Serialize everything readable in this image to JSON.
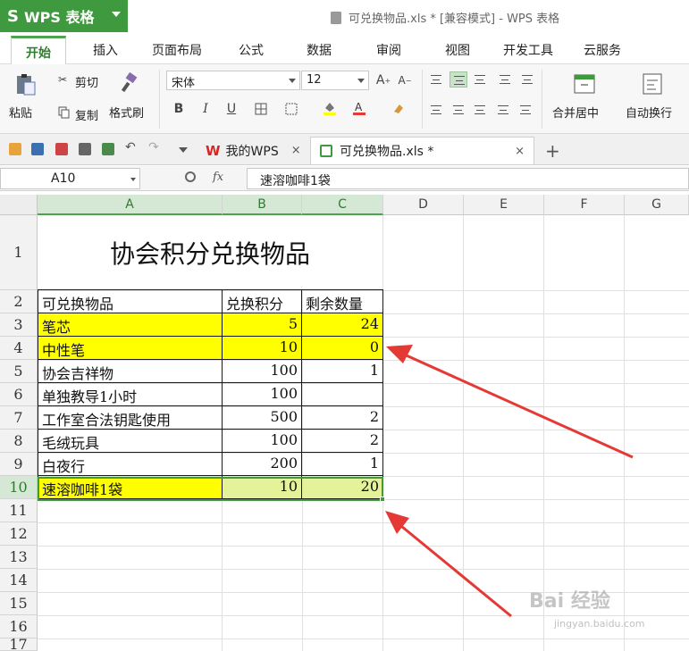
{
  "app": {
    "name": "WPS 表格",
    "logo": "S",
    "window_title": "可兑换物品.xls * [兼容模式] - WPS 表格"
  },
  "menu": [
    "开始",
    "插入",
    "页面布局",
    "公式",
    "数据",
    "审阅",
    "视图",
    "开发工具",
    "云服务"
  ],
  "ribbon": {
    "paste": "粘贴",
    "cut": "剪切",
    "copy": "复制",
    "format_painter": "格式刷",
    "font_name": "宋体",
    "font_size": "12",
    "bold": "B",
    "italic": "I",
    "underline": "U",
    "merge_center": "合并居中",
    "wrap_text": "自动换行"
  },
  "tabs": [
    {
      "label": "我的WPS",
      "close": "×"
    },
    {
      "label": "可兑换物品.xls *",
      "close": "×"
    }
  ],
  "new_tab": "+",
  "formula_bar": {
    "cell_ref": "A10",
    "fx": "fx",
    "content": "速溶咖啡1袋"
  },
  "columns": [
    "A",
    "B",
    "C",
    "D",
    "E",
    "F",
    "G"
  ],
  "rows": [
    "1",
    "2",
    "3",
    "4",
    "5",
    "6",
    "7",
    "8",
    "9",
    "10",
    "11",
    "12",
    "13",
    "14",
    "15",
    "16",
    "17"
  ],
  "sheet": {
    "title": "协会积分兑换物品",
    "headers": [
      "可兑换物品",
      "兑换积分",
      "剩余数量"
    ],
    "data": [
      {
        "item": "笔芯",
        "points": "5",
        "qty": "24",
        "highlight": true
      },
      {
        "item": "中性笔",
        "points": "10",
        "qty": "0",
        "highlight": true
      },
      {
        "item": "协会吉祥物",
        "points": "100",
        "qty": "1",
        "highlight": false
      },
      {
        "item": "单独教导1小时",
        "points": "100",
        "qty": "",
        "highlight": false
      },
      {
        "item": "工作室合法钥匙使用",
        "points": "500",
        "qty": "2",
        "highlight": false
      },
      {
        "item": "毛绒玩具",
        "points": "100",
        "qty": "2",
        "highlight": false
      },
      {
        "item": "白夜行",
        "points": "200",
        "qty": "1",
        "highlight": false
      },
      {
        "item": "速溶咖啡1袋",
        "points": "10",
        "qty": "20",
        "highlight": true
      }
    ]
  },
  "colors": {
    "accent": "#3f9a3f",
    "highlight": "#ffff00",
    "arrow": "#e53935"
  },
  "watermark": {
    "main": "Bai 经验",
    "sub": "jingyan.baidu.com"
  }
}
